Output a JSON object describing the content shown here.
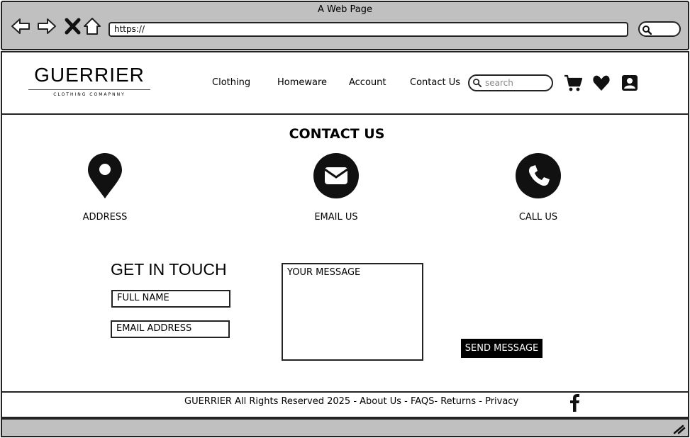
{
  "window": {
    "title": "A Web Page",
    "url": "https://"
  },
  "brand": {
    "name": "GUERRIER",
    "tagline": "CLOTHING COMAPNNY"
  },
  "nav": {
    "items": [
      {
        "label": "Clothing"
      },
      {
        "label": "Homeware"
      },
      {
        "label": "Account"
      },
      {
        "label": "Contact Us"
      }
    ],
    "search_placeholder": "search",
    "icons": [
      "cart-icon",
      "heart-icon",
      "account-icon"
    ]
  },
  "contact": {
    "title": "CONTACT US",
    "options": [
      {
        "label": "ADDRESS",
        "icon": "map-pin-icon"
      },
      {
        "label": "EMAIL US",
        "icon": "envelope-icon"
      },
      {
        "label": "CALL US",
        "icon": "phone-icon"
      }
    ]
  },
  "form": {
    "title": "GET IN TOUCH",
    "name_placeholder": "FULL NAME",
    "email_placeholder": "EMAIL ADDRESS",
    "message_placeholder": "YOUR MESSAGE",
    "send_label": "SEND MESSAGE"
  },
  "footer": {
    "text": "GUERRIER All Rights Reserved 2025 - About Us - FAQS- Returns  - Privacy",
    "social_icon": "facebook-icon"
  },
  "colors": {
    "chrome": "#c0c0c0",
    "ink": "#000000",
    "page": "#ffffff"
  }
}
